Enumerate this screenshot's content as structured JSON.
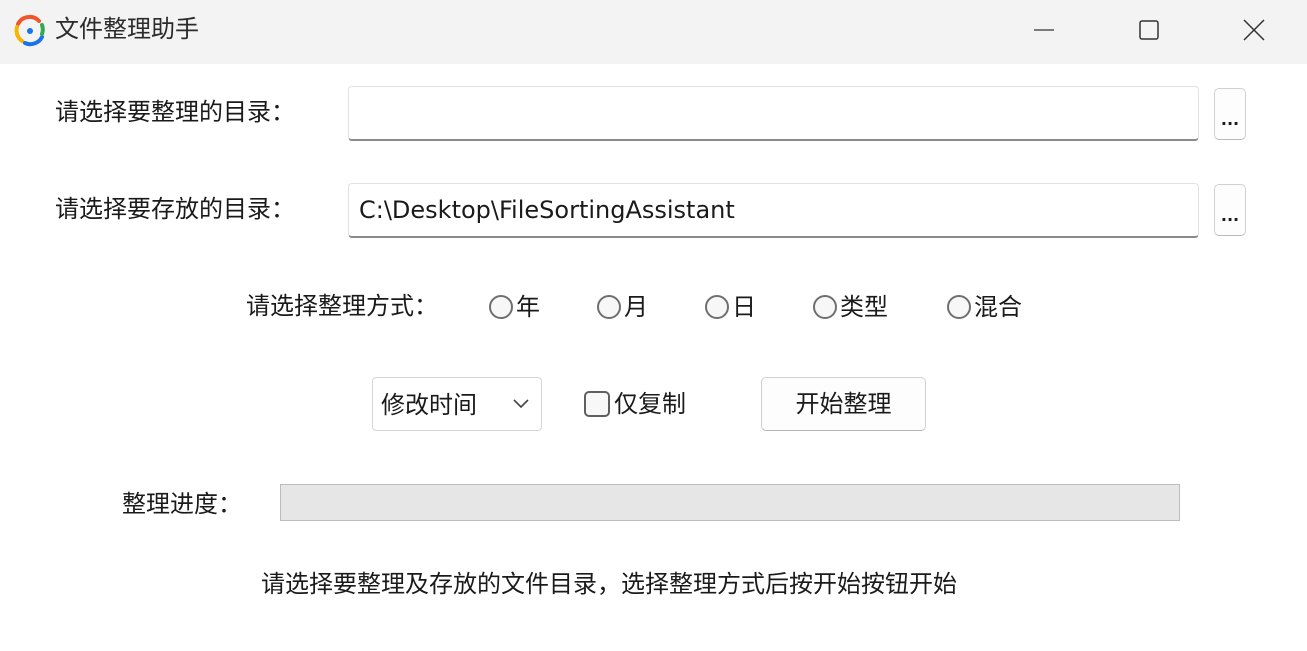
{
  "window": {
    "title": "文件整理助手",
    "icon": "app-refresh-icon",
    "controls": [
      "minimize-icon",
      "maximize-icon",
      "close-icon"
    ]
  },
  "source": {
    "label": "请选择要整理的目录：",
    "value": "",
    "browse_label": "..."
  },
  "target": {
    "label": "请选择要存放的目录：",
    "value": "C:\\Desktop\\FileSortingAssistant",
    "browse_label": "..."
  },
  "mode": {
    "label": "请选择整理方式：",
    "options": [
      {
        "label": "年",
        "selected": false
      },
      {
        "label": "月",
        "selected": false
      },
      {
        "label": "日",
        "selected": false
      },
      {
        "label": "类型",
        "selected": false
      },
      {
        "label": "混合",
        "selected": false
      }
    ]
  },
  "actions": {
    "time_select": "修改时间",
    "copy_only_label": "仅复制",
    "copy_only_checked": false,
    "start_label": "开始整理"
  },
  "progress": {
    "label": "整理进度：",
    "value": 0
  },
  "status": {
    "text": "请选择要整理及存放的文件目录，选择整理方式后按开始按钮开始"
  }
}
